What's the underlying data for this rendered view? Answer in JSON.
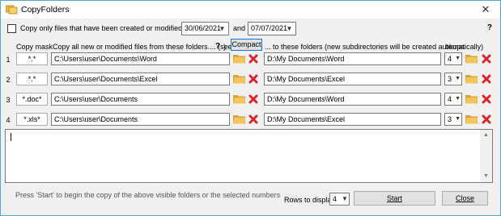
{
  "window": {
    "title": "CopyFolders",
    "close_label": "✕"
  },
  "filter": {
    "checkbox_label": "Copy only files that have been created or modified between",
    "checked": false,
    "date_from": "30/06/2021",
    "and_label": "and",
    "date_to": "07/07/2021",
    "help_label": "?"
  },
  "headers": {
    "copy_mask": "Copy mask",
    "source": "Copy all new or modified files from these folders.... (see Help in",
    "source_help": "?",
    "source_end": ")",
    "compact_button": "Compact",
    "dest": "... to these folders (new subdirectories will be created automatically)",
    "bkups": "bkups"
  },
  "rows": [
    {
      "num": "1",
      "mask": "*.*",
      "source": "C:\\Users\\user\\Documents\\Word",
      "dest": "D:\\My Documents\\Word",
      "bkups": "4"
    },
    {
      "num": "2",
      "mask": "*.*",
      "source": "C:\\Users\\user\\Documents\\Excel",
      "dest": "D:\\My Documents\\Excel",
      "bkups": "3"
    },
    {
      "num": "3",
      "mask": "*.doc*",
      "source": "C:\\Users\\user\\Documents",
      "dest": "D:\\My Documents\\Word",
      "bkups": "4"
    },
    {
      "num": "4",
      "mask": "*.xls*",
      "source": "C:\\Users\\user\\Documents",
      "dest": "D:\\My Documents\\Excel",
      "bkups": "3"
    }
  ],
  "log": {
    "text": ""
  },
  "footer": {
    "status": "Press 'Start' to begin the copy of the above visible folders or the selected numbers",
    "rows_label": "Rows to display:",
    "rows_value": "4",
    "start_button": "Start",
    "close_button": "Close"
  },
  "icons": {
    "app": "copy-folders-app-icon",
    "folder": "folder-open-icon",
    "delete": "red-x-delete-icon",
    "dropdown": "chevron-down-icon"
  },
  "colors": {
    "accent_border": "#5aa4d8",
    "folder_yellow": "#e8b84a",
    "delete_red": "#d9262c",
    "focus_blue": "#0078d7"
  }
}
